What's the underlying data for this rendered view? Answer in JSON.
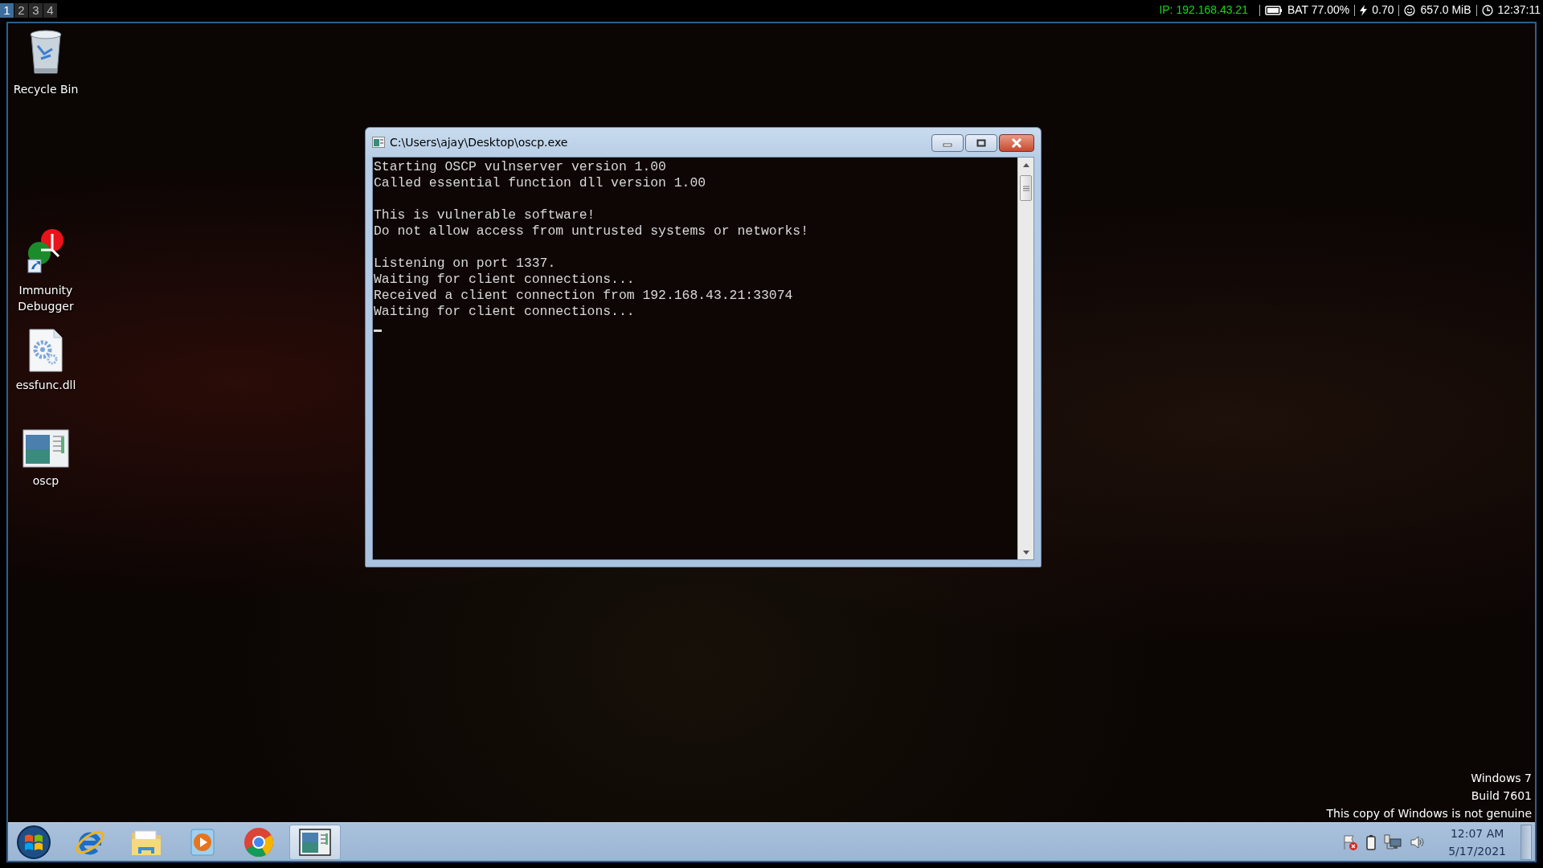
{
  "top_bar": {
    "workspaces": [
      {
        "label": "1",
        "selected": true
      },
      {
        "label": "2",
        "selected": false
      },
      {
        "label": "3",
        "selected": false
      },
      {
        "label": "4",
        "selected": false
      }
    ],
    "status": [
      {
        "kind": "ip",
        "text": "IP: 192.168.43.21"
      },
      {
        "kind": "battery",
        "text": "BAT 77.00%"
      },
      {
        "kind": "load",
        "text": "0.70"
      },
      {
        "kind": "memory",
        "text": "657.0 MiB"
      },
      {
        "kind": "clock",
        "text": "12:37:11"
      }
    ]
  },
  "desktop_icons": [
    {
      "kind": "recycle",
      "label": "Recycle Bin"
    },
    {
      "kind": "debugger",
      "label": "Immunity Debugger"
    },
    {
      "kind": "dll",
      "label": "essfunc.dll"
    },
    {
      "kind": "app",
      "label": "oscp"
    }
  ],
  "console_window": {
    "title": "C:\\Users\\ajay\\Desktop\\oscp.exe",
    "paragraphs": [
      [
        "Starting OSCP vulnserver version 1.00",
        "Called essential function dll version 1.00"
      ],
      [
        "This is vulnerable software!",
        "Do not allow access from untrusted systems or networks!"
      ],
      [
        "Listening on port 1337.",
        "Waiting for client connections...",
        "Received a client connection from 192.168.43.21:33074",
        "Waiting for client connections..."
      ]
    ],
    "cursor_visible": true
  },
  "genuine_notice": [
    "Windows 7",
    "Build 7601",
    "This copy of Windows is not genuine"
  ],
  "taskbar": {
    "buttons": [
      {
        "kind": "start",
        "selected": false
      },
      {
        "kind": "ie",
        "selected": false
      },
      {
        "kind": "explorer",
        "selected": false
      },
      {
        "kind": "media",
        "selected": false
      },
      {
        "kind": "chrome",
        "selected": false
      },
      {
        "kind": "app",
        "selected": true
      }
    ],
    "tray_icons": [
      {
        "kind": "flag"
      },
      {
        "kind": "battery"
      },
      {
        "kind": "network"
      },
      {
        "kind": "volume"
      }
    ],
    "clock": {
      "time": "12:07 AM",
      "date": "5/17/2021"
    }
  }
}
